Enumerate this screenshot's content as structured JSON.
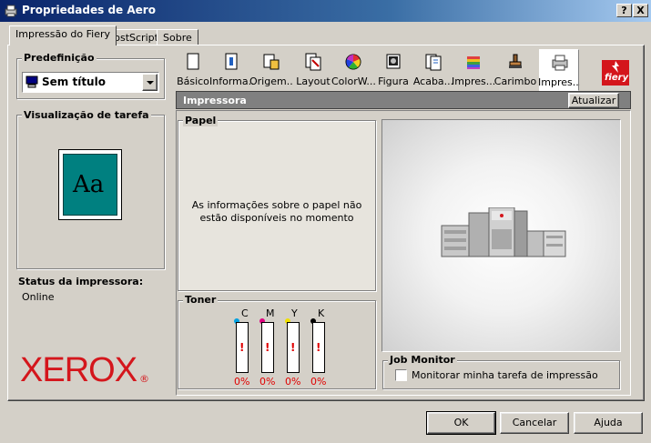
{
  "window": {
    "title": "Propriedades de Aero"
  },
  "title_buttons": {
    "help": "?",
    "close": "X"
  },
  "tabs": [
    {
      "label": "Impressão do Fiery"
    },
    {
      "label": "PostScript"
    },
    {
      "label": "Sobre"
    }
  ],
  "preset": {
    "group_title": "Predefinição",
    "value": "Sem título"
  },
  "job_preview": {
    "group_title": "Visualização de tarefa",
    "sample_text": "Aa"
  },
  "printer_status": {
    "label": "Status da impressora:",
    "value": "Online"
  },
  "brand": {
    "logo": "XEROX",
    "registered": "®",
    "fiery_logo": "fiery"
  },
  "iconbar": [
    {
      "label": "Básico",
      "icon": "document-icon"
    },
    {
      "label": "Informa...",
      "icon": "info-document-icon"
    },
    {
      "label": "Origem...",
      "icon": "paper-source-icon"
    },
    {
      "label": "Layout",
      "icon": "layout-icon"
    },
    {
      "label": "ColorW...",
      "icon": "color-wheel-icon"
    },
    {
      "label": "Figura",
      "icon": "image-icon"
    },
    {
      "label": "Acaba...",
      "icon": "finishing-icon"
    },
    {
      "label": "Impres...",
      "icon": "print-stack-icon"
    },
    {
      "label": "Carimbo",
      "icon": "stamp-icon"
    },
    {
      "label": "Impres...",
      "icon": "printer-icon"
    }
  ],
  "printer_panel": {
    "header": "Impressora",
    "refresh_button": "Atualizar",
    "paper_group": "Papel",
    "paper_message": "As informações sobre o papel não estão disponíveis no momento",
    "toner_group": "Toner",
    "toner": [
      {
        "label": "C",
        "percent": "0%",
        "warning": "!"
      },
      {
        "label": "M",
        "percent": "0%",
        "warning": "!"
      },
      {
        "label": "Y",
        "percent": "0%",
        "warning": "!"
      },
      {
        "label": "K",
        "percent": "0%",
        "warning": "!"
      }
    ],
    "job_monitor_group": "Job Monitor",
    "job_monitor_checkbox": "Monitorar minha tarefa de impressão",
    "job_monitor_checked": false
  },
  "footer": {
    "ok": "OK",
    "cancel": "Cancelar",
    "help": "Ajuda"
  },
  "colors": {
    "title_start": "#0a246a",
    "title_end": "#a6caf0",
    "xerox_red": "#d4161c",
    "preview_teal": "#008080",
    "warning_red": "#e00000"
  }
}
